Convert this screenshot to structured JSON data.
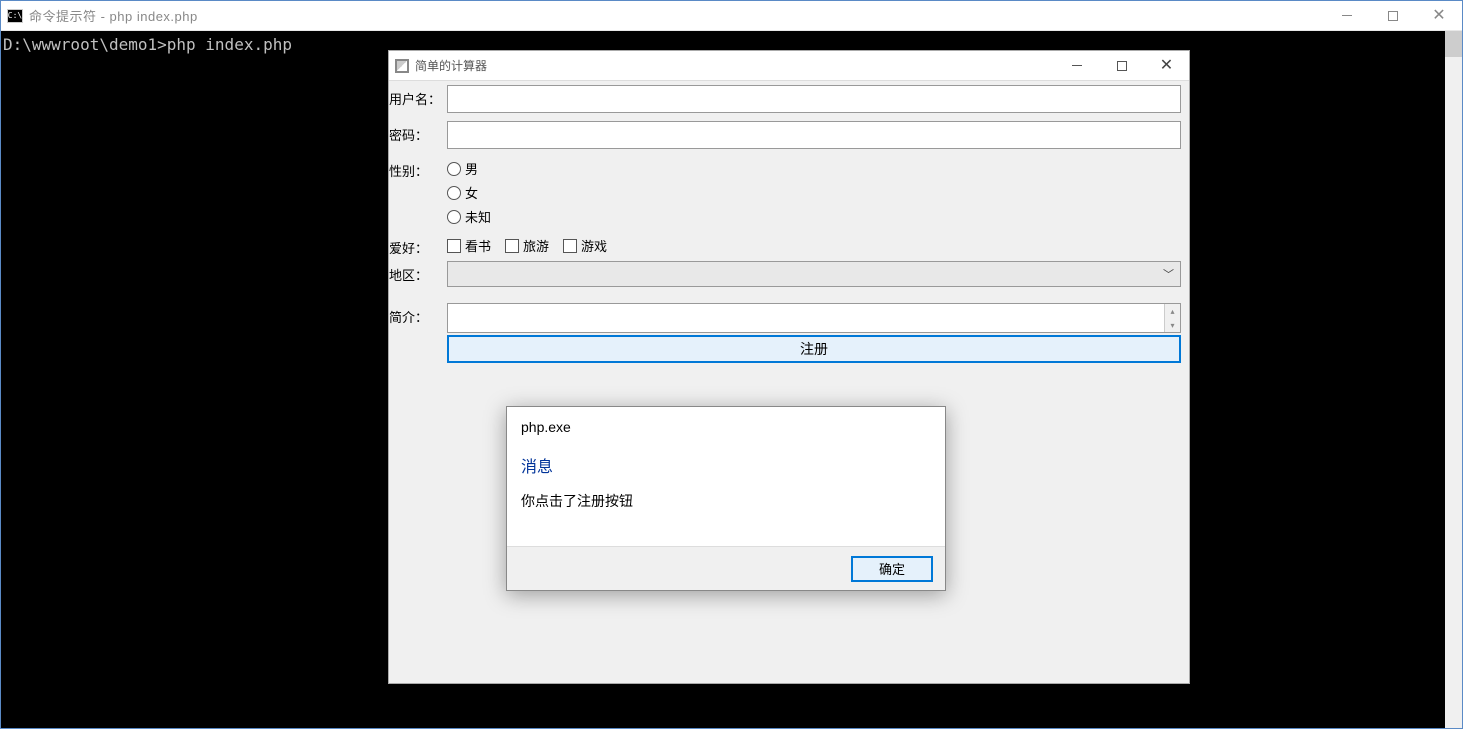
{
  "console": {
    "title": "命令提示符 - php  index.php",
    "prompt": "D:\\wwwroot\\demo1>php index.php"
  },
  "app": {
    "title": "简单的计算器",
    "labels": {
      "username": "用户名：",
      "password": "密码：",
      "gender": "性别：",
      "hobby": "爱好：",
      "region": "地区：",
      "bio": "简介："
    },
    "gender_options": {
      "male": "男",
      "female": "女",
      "unknown": "未知"
    },
    "hobby_options": {
      "reading": "看书",
      "travel": "旅游",
      "game": "游戏"
    },
    "submit_label": "注册",
    "username_value": "",
    "password_value": "",
    "region_value": "",
    "bio_value": ""
  },
  "dialog": {
    "title": "php.exe",
    "heading": "消息",
    "text": "你点击了注册按钮",
    "ok_label": "确定"
  }
}
